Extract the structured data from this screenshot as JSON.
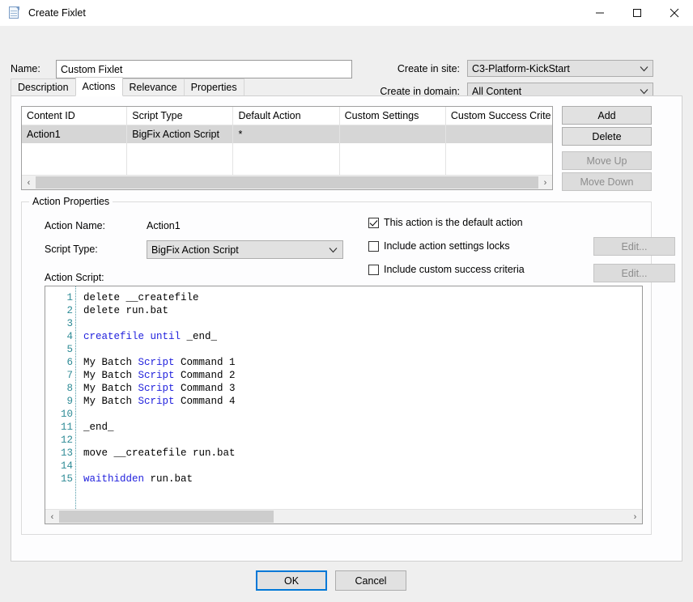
{
  "window": {
    "title": "Create Fixlet",
    "icon": "document-icon",
    "minimize_label": "–",
    "maximize_label": "□",
    "close_label": "✕"
  },
  "form": {
    "name_label": "Name:",
    "name_value": "Custom Fixlet",
    "name_placeholder": "",
    "site_label": "Create in site:",
    "site_value": "C3-Platform-KickStart",
    "domain_label": "Create in domain:",
    "domain_value": "All Content"
  },
  "tabs": [
    {
      "label": "Description",
      "active": false
    },
    {
      "label": "Actions",
      "active": true
    },
    {
      "label": "Relevance",
      "active": false
    },
    {
      "label": "Properties",
      "active": false
    }
  ],
  "grid": {
    "columns": [
      "Content ID",
      "Script Type",
      "Default Action",
      "Custom Settings",
      "Custom Success Crite"
    ],
    "rows": [
      {
        "content_id": "Action1",
        "script_type": "BigFix Action Script",
        "default_action": "*",
        "custom_settings": "",
        "custom_success": ""
      }
    ],
    "scroll_left_arrow": "‹",
    "scroll_right_arrow": "›"
  },
  "side_buttons": [
    {
      "label": "Add",
      "enabled": true
    },
    {
      "label": "Delete",
      "enabled": true
    },
    {
      "label": "Move Up",
      "enabled": false
    },
    {
      "label": "Move Down",
      "enabled": false
    }
  ],
  "action_properties": {
    "legend": "Action Properties",
    "action_name_label": "Action Name:",
    "action_name_value": "Action1",
    "script_type_label": "Script Type:",
    "script_type_value": "BigFix Action Script",
    "action_script_label": "Action Script:",
    "checkboxes": [
      {
        "label": "This action is the default action",
        "checked": true
      },
      {
        "label": "Include action settings locks",
        "checked": false
      },
      {
        "label": "Include custom success criteria",
        "checked": false
      }
    ],
    "edit_buttons": [
      {
        "label": "Edit...",
        "enabled": false
      },
      {
        "label": "Edit...",
        "enabled": false
      }
    ]
  },
  "editor": {
    "line_numbers": [
      "1",
      "2",
      "3",
      "4",
      "5",
      "6",
      "7",
      "8",
      "9",
      "10",
      "11",
      "12",
      "13",
      "14",
      "15"
    ],
    "lines": [
      [
        {
          "t": "delete __createfile",
          "k": false
        }
      ],
      [
        {
          "t": "delete run.bat",
          "k": false
        }
      ],
      [
        {
          "t": "",
          "k": false
        }
      ],
      [
        {
          "t": "createfile until",
          "k": true
        },
        {
          "t": " _end_",
          "k": false
        }
      ],
      [
        {
          "t": "",
          "k": false
        }
      ],
      [
        {
          "t": "My Batch ",
          "k": false
        },
        {
          "t": "Script",
          "k": true
        },
        {
          "t": " Command 1",
          "k": false
        }
      ],
      [
        {
          "t": "My Batch ",
          "k": false
        },
        {
          "t": "Script",
          "k": true
        },
        {
          "t": " Command 2",
          "k": false
        }
      ],
      [
        {
          "t": "My Batch ",
          "k": false
        },
        {
          "t": "Script",
          "k": true
        },
        {
          "t": " Command 3",
          "k": false
        }
      ],
      [
        {
          "t": "My Batch ",
          "k": false
        },
        {
          "t": "Script",
          "k": true
        },
        {
          "t": " Command 4",
          "k": false
        }
      ],
      [
        {
          "t": "",
          "k": false
        }
      ],
      [
        {
          "t": "_end_",
          "k": false
        }
      ],
      [
        {
          "t": "",
          "k": false
        }
      ],
      [
        {
          "t": "move __createfile run.bat",
          "k": false
        }
      ],
      [
        {
          "t": "",
          "k": false
        }
      ],
      [
        {
          "t": "waithidden",
          "k": true
        },
        {
          "t": " run.bat",
          "k": false
        }
      ]
    ],
    "scroll_left_arrow": "‹",
    "scroll_right_arrow": "›"
  },
  "footer": {
    "ok_label": "OK",
    "cancel_label": "Cancel"
  },
  "colors": {
    "accent": "#0078d7",
    "keyword": "#2222dd",
    "line_number": "#2e8b96",
    "selection_row": "#d6d6d6",
    "control_face": "#e1e1e1"
  }
}
